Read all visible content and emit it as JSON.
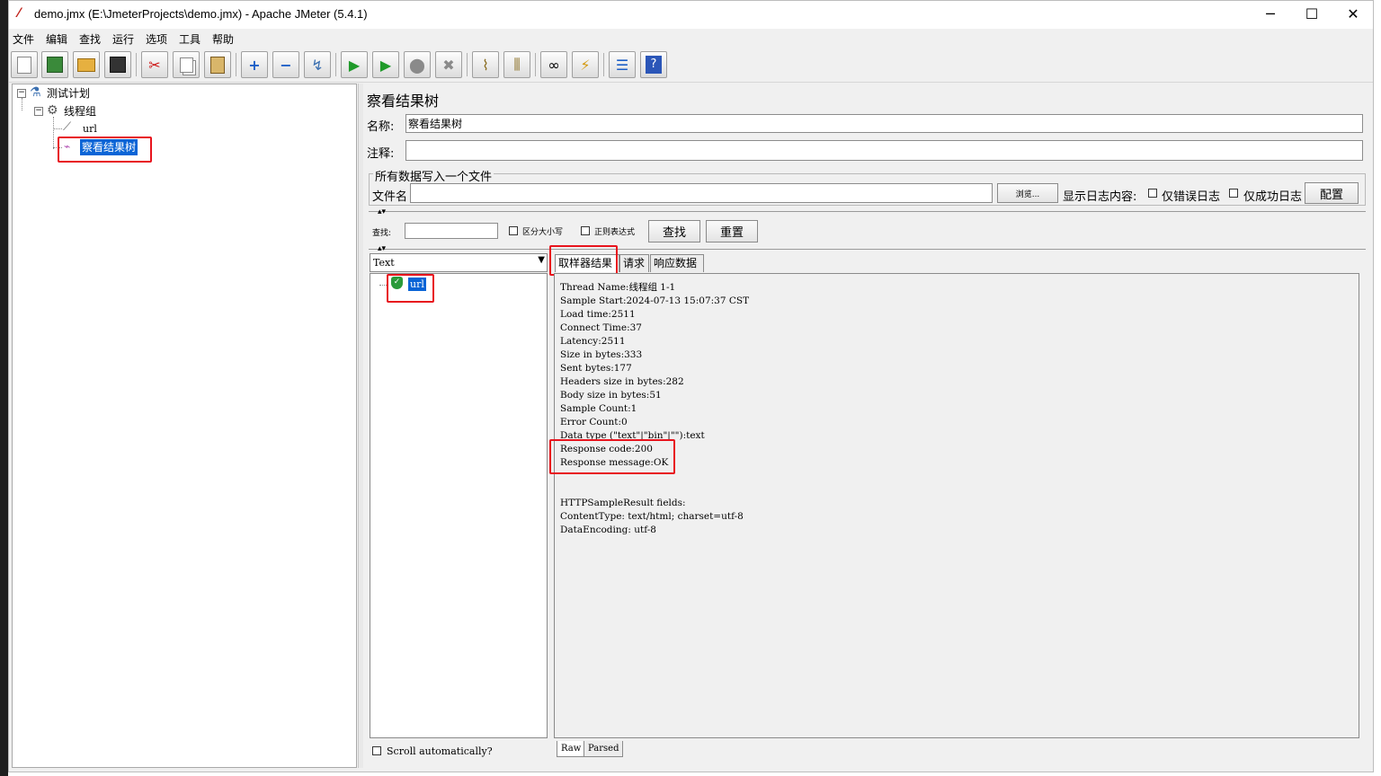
{
  "window": {
    "title": "demo.jmx (E:\\JmeterProjects\\demo.jmx) - Apache JMeter (5.4.1)",
    "minimize": "─",
    "maximize": "☐",
    "close": "✕"
  },
  "menu": [
    "文件",
    "编辑",
    "查找",
    "运行",
    "选项",
    "工具",
    "帮助"
  ],
  "toolbar_icons": [
    "new-icon",
    "templates-icon",
    "open-icon",
    "save-icon",
    "cut-icon",
    "copy-icon",
    "paste-icon",
    "expand-icon",
    "collapse-icon",
    "toggle-icon",
    "start-icon",
    "start-no-pause-icon",
    "stop-icon",
    "shutdown-icon",
    "clear-icon",
    "clear-all-icon",
    "search-icon",
    "reset-search-icon",
    "function-helper-icon",
    "help-icon"
  ],
  "tree": {
    "test_plan": "测试计划",
    "thread_group": "线程组",
    "sampler": "url",
    "listener": "察看结果树"
  },
  "listener": {
    "title": "察看结果树",
    "name_label": "名称:",
    "name_value": "察看结果树",
    "comment_label": "注释:",
    "comment_value": "",
    "file_section": "所有数据写入一个文件",
    "filename_label": "文件名",
    "filename_value": "",
    "browse": "浏览...",
    "log_label": "显示日志内容:",
    "errors_only": "仅错误日志",
    "success_only": "仅成功日志",
    "configure": "配置"
  },
  "search": {
    "label": "查找:",
    "value": "",
    "case_sensitive": "区分大小写",
    "regex": "正则表达式",
    "find": "查找",
    "reset": "重置"
  },
  "renderer": {
    "selected": "Text"
  },
  "results_tree": {
    "item": "url",
    "scroll_auto": "Scroll automatically?"
  },
  "tabs": [
    "取样器结果",
    "请求",
    "响应数据"
  ],
  "sampler_result_lines": [
    "Thread Name:线程组 1-1",
    "Sample Start:2024-07-13 15:07:37 CST",
    "Load time:2511",
    "Connect Time:37",
    "Latency:2511",
    "Size in bytes:333",
    "Sent bytes:177",
    "Headers size in bytes:282",
    "Body size in bytes:51",
    "Sample Count:1",
    "Error Count:0",
    "Data type (\"text\"|\"bin\"|\"\"):text",
    "Response code:200",
    "Response message:OK",
    "",
    "",
    "HTTPSampleResult fields:",
    "ContentType: text/html; charset=utf-8",
    "DataEncoding: utf-8"
  ],
  "bottom_tabs": [
    "Raw",
    "Parsed"
  ]
}
